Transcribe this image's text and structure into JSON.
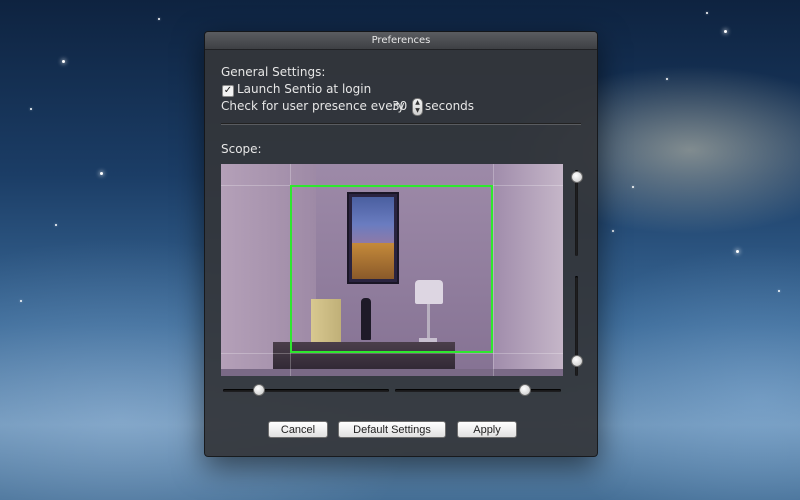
{
  "window": {
    "title": "Preferences"
  },
  "general": {
    "heading": "General Settings:",
    "launch_label": "Launch Sentio at login",
    "launch_checked": true,
    "presence_prefix": "Check for user presence every",
    "presence_value": "30",
    "presence_suffix": "seconds"
  },
  "scope": {
    "heading": "Scope:",
    "highlight_color": "#2ee82e",
    "vertical_slider": {
      "top_value": 0.0,
      "bottom_value": 1.0
    },
    "horizontal_slider": {
      "left_value": 0.2,
      "right_value": 0.8
    }
  },
  "buttons": {
    "cancel": "Cancel",
    "defaults": "Default Settings",
    "apply": "Apply"
  }
}
